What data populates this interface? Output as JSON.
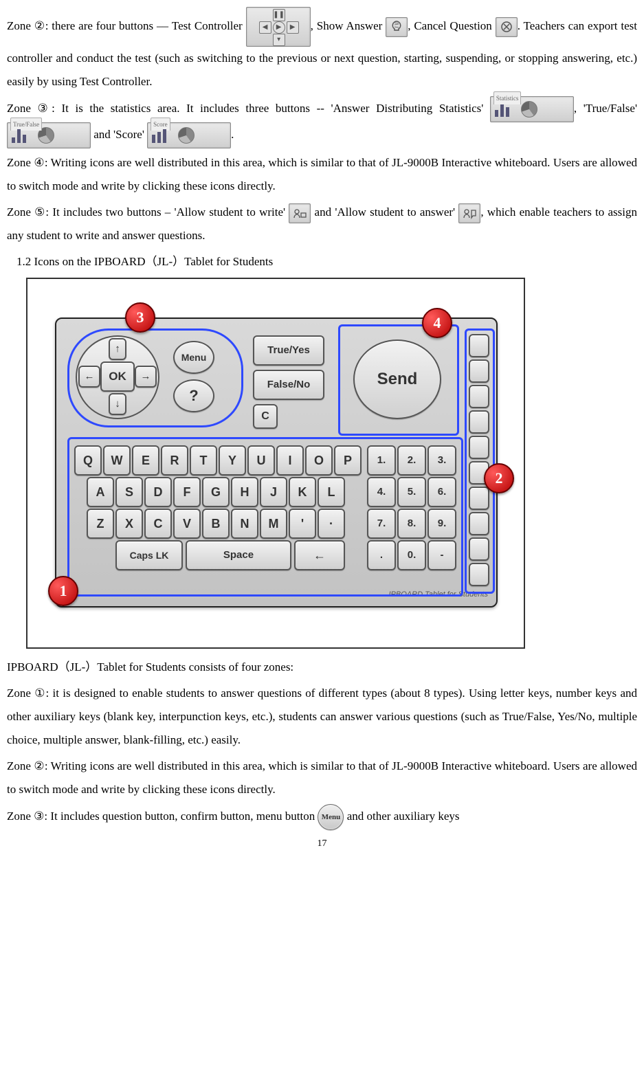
{
  "para1": {
    "a": "Zone ②: there are four buttons",
    "dash": " –– ",
    "b": "Test Controller ",
    "c": ", Show Answer ",
    "d": ", Cancel Question ",
    "e": ". Teachers can export test controller and conduct the test (such as switching to the previous or next question, starting, suspending, or stopping answering, etc.) easily by using Test Controller."
  },
  "para2": {
    "a": "Zone ③",
    "colon": ": ",
    "b": "It is the statistics area. It includes three buttons -- 'Answer Distributing Statistics' ",
    "c": ", 'True/False' ",
    "d": " and 'Score' ",
    "e": "."
  },
  "stats_labels": {
    "ans": "Statistics",
    "tf": "True/False",
    "score": "Score"
  },
  "para3": "Zone ④: Writing icons are well distributed in this area, which is similar to that of JL-9000B Interactive whiteboard. Users are allowed to switch mode and write by clicking these icons directly.",
  "para4": {
    "a": "Zone ⑤: It includes two buttons – 'Allow student to write'",
    "b": " and 'Allow student to answer'",
    "c": ", which enable teachers to assign any student to write and answer questions."
  },
  "heading": "1.2 Icons on the IPBOARD（JL-）Tablet for Students",
  "tablet": {
    "zones": {
      "1": "1",
      "2": "2",
      "3": "3",
      "4": "4"
    },
    "ok": "OK",
    "menu": "Menu",
    "q": "?",
    "true": "True/Yes",
    "false": "False/No",
    "send": "Send",
    "c": "C",
    "caps": "Caps LK",
    "space": "Space",
    "back": "←",
    "row1": [
      "Q",
      "W",
      "E",
      "R",
      "T",
      "Y",
      "U",
      "I",
      "O",
      "P"
    ],
    "row2": [
      "A",
      "S",
      "D",
      "F",
      "G",
      "H",
      "J",
      "K",
      "L"
    ],
    "row3": [
      "Z",
      "X",
      "C",
      "V",
      "B",
      "N",
      "M",
      "'",
      "·"
    ],
    "num": [
      "1.",
      "2.",
      "3.",
      "4.",
      "5.",
      "6.",
      "7.",
      "8.",
      "9.",
      ".",
      "0.",
      "-"
    ],
    "label": "IPBOARD Tablet for Students"
  },
  "para5": "IPBOARD（JL-）Tablet for Students consists of four zones:",
  "para6": "Zone ①: it is designed to enable students to answer questions of different types (about 8 types). Using letter keys, number keys and other auxiliary keys (blank key, interpunction keys, etc.), students can answer various questions (such as True/False, Yes/No, multiple choice, multiple answer, blank-filling, etc.) easily.",
  "para7": "Zone ②: Writing icons are well distributed in this area, which is similar to that of JL-9000B Interactive whiteboard. Users are allowed to switch mode and write by clicking these icons directly.",
  "para8": {
    "a": "Zone ③: It includes question button, confirm button, menu button ",
    "b": " and other auxiliary keys"
  },
  "menu_label": "Menu",
  "page": "17"
}
